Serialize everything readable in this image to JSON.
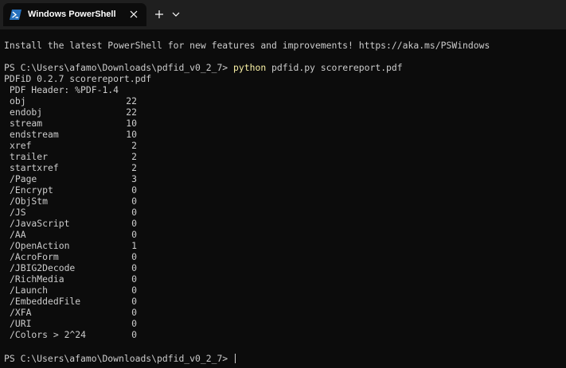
{
  "window": {
    "tab_title": "Windows PowerShell",
    "tab_icon": "powershell-icon",
    "close_icon": "close-icon",
    "new_tab_icon": "plus-icon",
    "dropdown_icon": "chevron-down-icon"
  },
  "terminal": {
    "banner": "Install the latest PowerShell for new features and improvements! https://aka.ms/PSWindows",
    "prompt": "PS C:\\Users\\afamo\\Downloads\\pdfid_v0_2_7> ",
    "command": "python",
    "command_args": " pdfid.py scorereport.pdf",
    "version_line": "PDFiD 0.2.7 scorereport.pdf",
    "header_line": " PDF Header: %PDF-1.4",
    "rows": [
      {
        "name": "obj",
        "value": "22"
      },
      {
        "name": "endobj",
        "value": "22"
      },
      {
        "name": "stream",
        "value": "10"
      },
      {
        "name": "endstream",
        "value": "10"
      },
      {
        "name": "xref",
        "value": "2"
      },
      {
        "name": "trailer",
        "value": "2"
      },
      {
        "name": "startxref",
        "value": "2"
      },
      {
        "name": "/Page",
        "value": "3"
      },
      {
        "name": "/Encrypt",
        "value": "0"
      },
      {
        "name": "/ObjStm",
        "value": "0"
      },
      {
        "name": "/JS",
        "value": "0"
      },
      {
        "name": "/JavaScript",
        "value": "0"
      },
      {
        "name": "/AA",
        "value": "0"
      },
      {
        "name": "/OpenAction",
        "value": "1"
      },
      {
        "name": "/AcroForm",
        "value": "0"
      },
      {
        "name": "/JBIG2Decode",
        "value": "0"
      },
      {
        "name": "/RichMedia",
        "value": "0"
      },
      {
        "name": "/Launch",
        "value": "0"
      },
      {
        "name": "/EmbeddedFile",
        "value": "0"
      },
      {
        "name": "/XFA",
        "value": "0"
      },
      {
        "name": "/URI",
        "value": "0"
      },
      {
        "name": "/Colors > 2^24",
        "value": "0"
      }
    ],
    "final_prompt": "PS C:\\Users\\afamo\\Downloads\\pdfid_v0_2_7> "
  },
  "colors": {
    "background": "#0c0c0c",
    "titlebar": "#1f1f1f",
    "text": "#cccccc",
    "command": "#f9f1a5"
  }
}
